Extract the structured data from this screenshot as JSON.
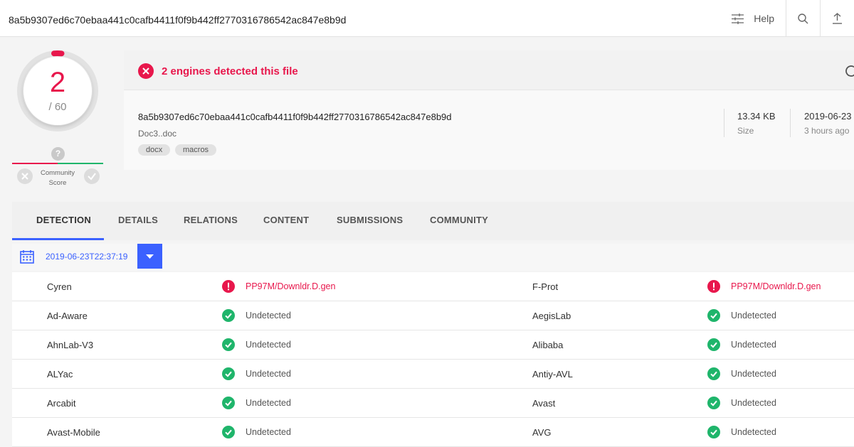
{
  "search": {
    "query": "8a5b9307ed6c70ebaa441c0cafb4411f0f9b442ff2770316786542ac847e8b9d"
  },
  "toolbar": {
    "help_label": "Help"
  },
  "score": {
    "detections": "2",
    "total": "/ 60"
  },
  "community": {
    "question": "?",
    "label_line1": "Community",
    "label_line2": "Score"
  },
  "summary": {
    "alert": "2 engines detected this file",
    "hash": "8a5b9307ed6c70ebaa441c0cafb4411f0f9b442ff2770316786542ac847e8b9d",
    "filename": "Doc3..doc",
    "tags": [
      "docx",
      "macros"
    ],
    "size_value": "13.34 KB",
    "size_label": "Size",
    "date_value": "2019-06-23",
    "date_label": "3 hours ago"
  },
  "tabs": [
    "DETECTION",
    "DETAILS",
    "RELATIONS",
    "CONTENT",
    "SUBMISSIONS",
    "COMMUNITY"
  ],
  "filter": {
    "date": "2019-06-23T22:37:19"
  },
  "results": [
    {
      "left_engine": "Cyren",
      "left_result": "PP97M/Downldr.D.gen",
      "left_status": "malicious",
      "right_engine": "F-Prot",
      "right_result": "PP97M/Downldr.D.gen",
      "right_status": "malicious"
    },
    {
      "left_engine": "Ad-Aware",
      "left_result": "Undetected",
      "left_status": "clean",
      "right_engine": "AegisLab",
      "right_result": "Undetected",
      "right_status": "clean"
    },
    {
      "left_engine": "AhnLab-V3",
      "left_result": "Undetected",
      "left_status": "clean",
      "right_engine": "Alibaba",
      "right_result": "Undetected",
      "right_status": "clean"
    },
    {
      "left_engine": "ALYac",
      "left_result": "Undetected",
      "left_status": "clean",
      "right_engine": "Antiy-AVL",
      "right_result": "Undetected",
      "right_status": "clean"
    },
    {
      "left_engine": "Arcabit",
      "left_result": "Undetected",
      "left_status": "clean",
      "right_engine": "Avast",
      "right_result": "Undetected",
      "right_status": "clean"
    },
    {
      "left_engine": "Avast-Mobile",
      "left_result": "Undetected",
      "left_status": "clean",
      "right_engine": "AVG",
      "right_result": "Undetected",
      "right_status": "clean"
    }
  ],
  "colors": {
    "accent": "#3b61ff",
    "malicious": "#e8174c",
    "clean": "#1fb56b"
  }
}
